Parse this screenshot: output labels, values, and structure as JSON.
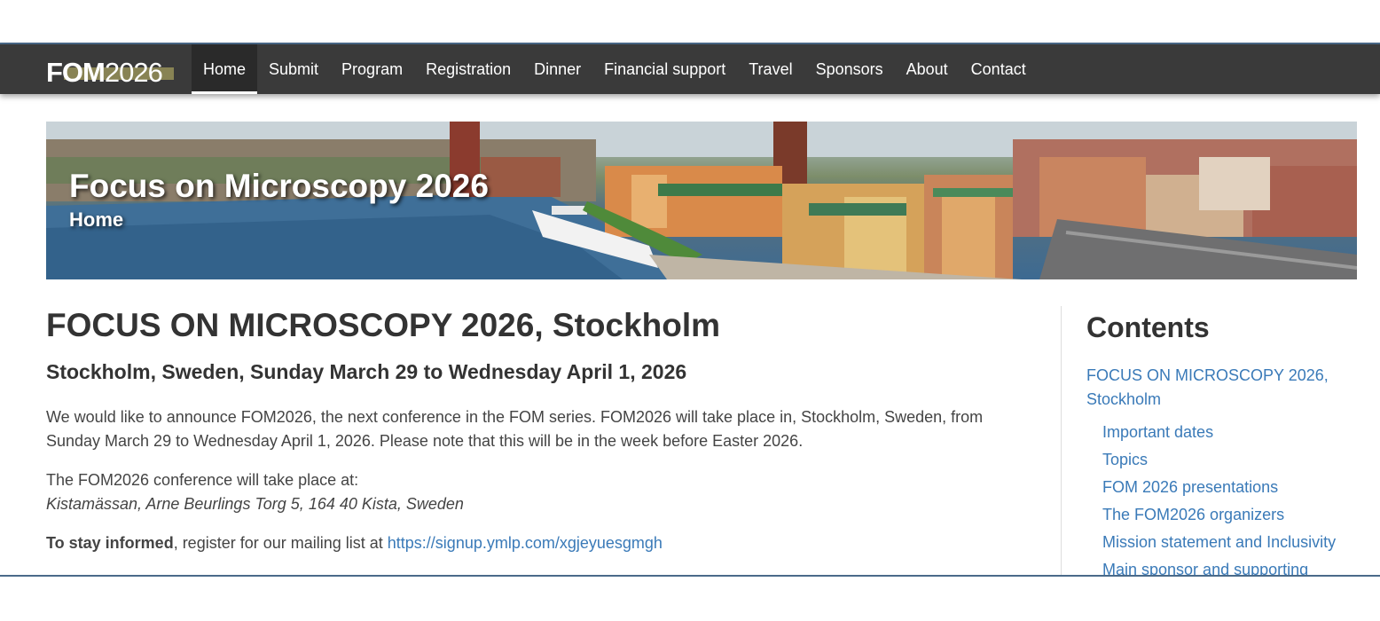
{
  "navbar": {
    "logo_bold": "FOM",
    "logo_year": "2026",
    "items": [
      {
        "label": "Home",
        "active": true
      },
      {
        "label": "Submit"
      },
      {
        "label": "Program"
      },
      {
        "label": "Registration"
      },
      {
        "label": "Dinner"
      },
      {
        "label": "Financial support"
      },
      {
        "label": "Travel"
      },
      {
        "label": "Sponsors"
      },
      {
        "label": "About"
      },
      {
        "label": "Contact"
      }
    ]
  },
  "hero": {
    "title": "Focus on Microscopy 2026",
    "subtitle": "Home"
  },
  "main": {
    "title": "FOCUS ON MICROSCOPY 2026, Stockholm",
    "subtitle": "Stockholm, Sweden, Sunday March 29 to Wednesday April 1, 2026",
    "intro": "We would like to announce FOM2026, the next conference in the FOM series. FOM2026 will take place in, Stockholm, Sweden, from Sunday March 29 to Wednesday April 1, 2026. Please note that this will be in the week before Easter 2026.",
    "venue_label": "The FOM2026 conference will take place at:",
    "venue_address": "Kistamässan, Arne Beurlings Torg 5, 164 40 Kista, Sweden",
    "informed_bold": "To stay informed",
    "informed_text": ", register for our mailing list at ",
    "mailing_link": "https://signup.ymlp.com/xgjeyuesgmgh"
  },
  "sidebar": {
    "heading": "Contents",
    "main_item": "FOCUS ON MICROSCOPY 2026, Stockholm",
    "items": [
      "Important dates",
      "Topics",
      "FOM 2026 presentations",
      "The FOM2026 organizers",
      "Mission statement and Inclusivity",
      "Main sponsor and supporting"
    ]
  },
  "colors": {
    "navbar_bg": "#3a3a3a",
    "link": "#3a7ab8",
    "text": "#333333"
  }
}
